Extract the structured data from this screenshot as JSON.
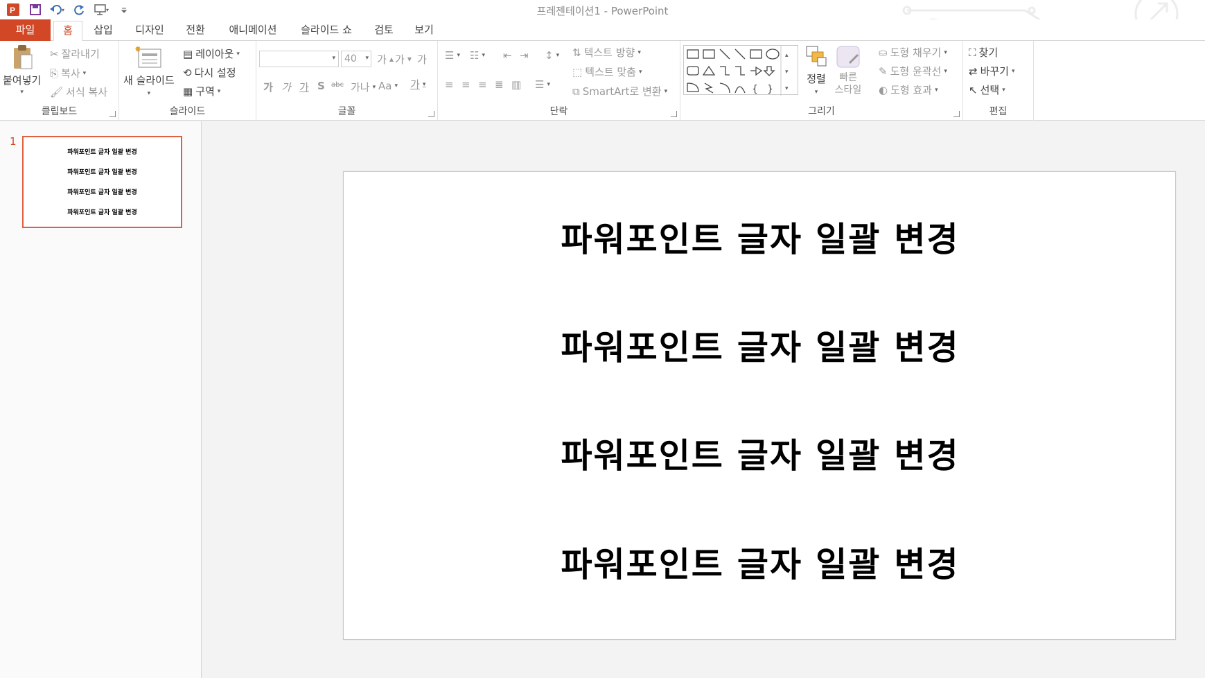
{
  "window": {
    "title": "프레젠테이션1 - PowerPoint"
  },
  "qat": {
    "icons": [
      "powerpoint-icon",
      "save-icon",
      "undo-icon",
      "redo-icon",
      "start-from-beginning-icon",
      "customize-qat-icon"
    ]
  },
  "tabs": {
    "file": "파일",
    "home": "홈",
    "insert": "삽입",
    "design": "디자인",
    "transitions": "전환",
    "animations": "애니메이션",
    "slideshow": "슬라이드 쇼",
    "review": "검토",
    "view": "보기"
  },
  "ribbon": {
    "clipboard": {
      "label": "클립보드",
      "paste": "붙여넣기",
      "cut": "잘라내기",
      "copy": "복사",
      "format_painter": "서식 복사"
    },
    "slides": {
      "label": "슬라이드",
      "new_slide": "새 슬라이드",
      "layout": "레이아웃",
      "reset": "다시 설정",
      "section": "구역"
    },
    "font": {
      "label": "글꼴",
      "font_name": "",
      "font_size": "40",
      "bold": "가",
      "italic": "가",
      "underline": "가",
      "shadow": "S",
      "strike": "abc",
      "spacing": "가나",
      "case": "Aa",
      "color": "가"
    },
    "paragraph": {
      "label": "단락",
      "text_direction": "텍스트 방향",
      "align_text": "텍스트 맞춤",
      "smartart": "SmartArt로 변환"
    },
    "drawing": {
      "label": "그리기",
      "arrange": "정렬",
      "quick_styles": "빠른\n스타일",
      "shape_fill": "도형 채우기",
      "shape_outline": "도형 윤곽선",
      "shape_effects": "도형 효과"
    },
    "editing": {
      "label": "편집",
      "find": "찾기",
      "replace": "바꾸기",
      "select": "선택"
    }
  },
  "thumbnails": [
    {
      "number": "1",
      "lines": [
        "파워포인트 글자 일괄 변경",
        "파워포인트 글자 일괄 변경",
        "파워포인트 글자 일괄 변경",
        "파워포인트 글자 일괄 변경"
      ]
    }
  ],
  "slide": {
    "lines": [
      "파워포인트 글자 일괄 변경",
      "파워포인트 글자 일괄 변경",
      "파워포인트 글자 일괄 변경",
      "파워포인트 글자 일괄 변경"
    ]
  },
  "colors": {
    "accent": "#d24726",
    "thumb_border": "#e0613f"
  }
}
